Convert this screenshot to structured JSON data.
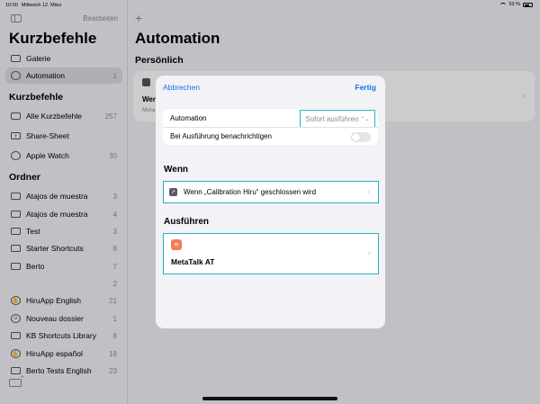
{
  "status_bar": {
    "time": "10:00",
    "date": "Mittwoch 12. März",
    "battery": "53 %"
  },
  "sidebar": {
    "edit_label": "Bearbeiten",
    "title": "Kurzbefehle",
    "top_items": [
      {
        "label": "Galerie",
        "count": "",
        "icon": "gallery-icon"
      },
      {
        "label": "Automation",
        "count": "1",
        "icon": "clock-icon"
      }
    ],
    "section_shortcuts": "Kurzbefehle",
    "shortcut_items": [
      {
        "label": "Alle Kurzbefehle",
        "count": "257"
      },
      {
        "label": "Share-Sheet",
        "count": ""
      },
      {
        "label": "Apple Watch",
        "count": "30"
      }
    ],
    "section_folders": "Ordner",
    "folder_items": [
      {
        "label": "Atajos de muestra",
        "count": "3"
      },
      {
        "label": "Atajos de muestra",
        "count": "4"
      },
      {
        "label": "Test",
        "count": "3"
      },
      {
        "label": "Starter Shortcuts",
        "count": "8"
      },
      {
        "label": "Berto",
        "count": "7"
      },
      {
        "label": "",
        "count": "2"
      },
      {
        "label": "HiruApp English",
        "count": "21"
      },
      {
        "label": "Nouveau dossier",
        "count": "1"
      },
      {
        "label": "KB Shortcuts Library",
        "count": "8"
      },
      {
        "label": "HiruApp español",
        "count": "18"
      },
      {
        "label": "Berto Tests English",
        "count": "23"
      }
    ]
  },
  "main": {
    "title": "Automation",
    "section": "Persönlich",
    "bg_card_title": "Wen",
    "bg_card_sub": "Meta"
  },
  "modal": {
    "cancel_label": "Abbrechen",
    "done_label": "Fertig",
    "automation_label": "Automation",
    "run_option": "Sofort ausführen",
    "notify_label": "Bei Ausführung benachrichtigen",
    "notify_on": false,
    "when_title": "Wenn",
    "trigger_label": "Wenn „Calibration Hiru“ geschlossen wird",
    "run_title": "Ausführen",
    "action_label": "MetaTalk AT"
  },
  "colors": {
    "accent": "#1a73e8",
    "highlight": "#2ab0c2",
    "app_icon": "#f47c55"
  }
}
